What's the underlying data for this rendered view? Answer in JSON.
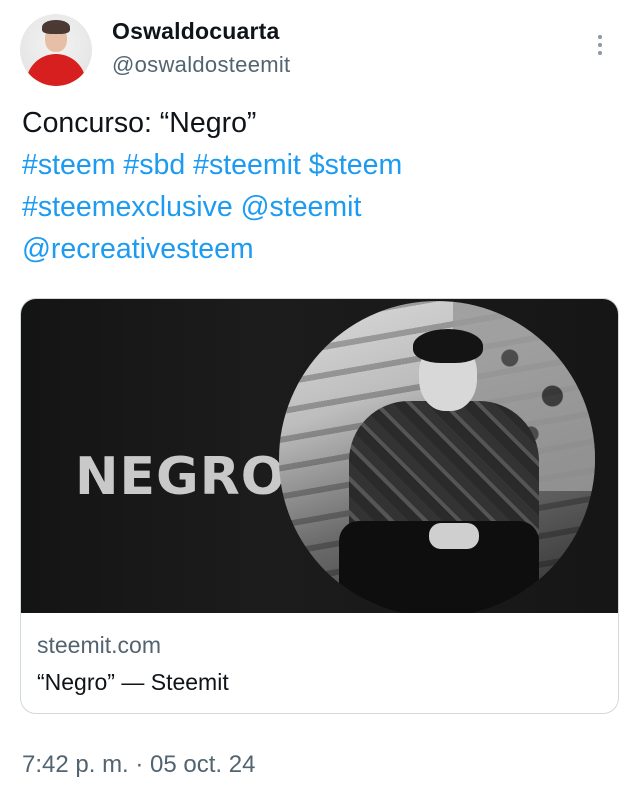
{
  "author": {
    "display_name": "Oswaldocuarta",
    "handle": "@oswaldosteemit"
  },
  "tweet": {
    "lines": {
      "line1": "Concurso: “Negro”",
      "tags_line2": [
        "#steem",
        "#sbd",
        "#steemit",
        "$steem"
      ],
      "tags_line3": [
        "#steemexclusive",
        "@steemit"
      ],
      "tags_line4": [
        "@recreativesteem"
      ]
    }
  },
  "card": {
    "image_title": "NEGRO",
    "domain": "steemit.com",
    "title": "“Negro” — Steemit"
  },
  "timestamp": "7:42 p. m. · 05 oct. 24",
  "colors": {
    "link": "#1d9bf0",
    "text": "#0f1419",
    "muted": "#536471",
    "border": "#cfd9de"
  },
  "icons": {
    "more": "more-vertical-icon"
  }
}
